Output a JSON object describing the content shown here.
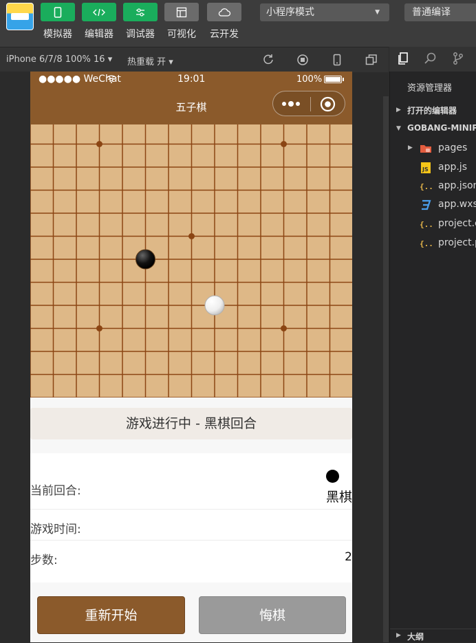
{
  "toolbar": {
    "buttons": [
      {
        "label": "模拟器",
        "icon": "phone-icon"
      },
      {
        "label": "编辑器",
        "icon": "code-icon"
      },
      {
        "label": "调试器",
        "icon": "sliders-icon"
      },
      {
        "label": "可视化",
        "icon": "layout-icon"
      },
      {
        "label": "云开发",
        "icon": "cloud-icon"
      }
    ],
    "mode": "小程序模式",
    "compile": "普通编译"
  },
  "subbar": {
    "device": "iPhone 6/7/8 100% 16 ▾",
    "hot_reload": "热重载 开 ▾"
  },
  "explorer": {
    "title": "资源管理器",
    "open_editors": "打开的编辑器",
    "project": "GOBANG-MINIPROGRAM",
    "files": [
      {
        "name": "pages",
        "icon": "folder-icon"
      },
      {
        "name": "app.js",
        "icon": "js-file-icon"
      },
      {
        "name": "app.json",
        "icon": "json-file-icon"
      },
      {
        "name": "app.wxss",
        "icon": "css-file-icon"
      },
      {
        "name": "project.config.json",
        "icon": "json-file-icon"
      },
      {
        "name": "project.private.config.json",
        "icon": "json-file-icon"
      }
    ],
    "outline": "大纲"
  },
  "phone": {
    "carrier": "●●●●● WeChat",
    "time": "19:01",
    "battery": "100%",
    "title": "五子棋",
    "game_status": "游戏进行中 - 黑棋回合",
    "rows": [
      {
        "label": "当前回合:",
        "value": "黑棋"
      },
      {
        "label": "游戏时间:",
        "value": ""
      },
      {
        "label": "步数:",
        "value": "2"
      }
    ],
    "restart": "重新开始",
    "undo": "悔棋"
  },
  "board": {
    "grid_lines": 14,
    "stones": [
      {
        "color": "black",
        "col": 5,
        "row": 6
      },
      {
        "color": "white",
        "col": 8,
        "row": 8
      }
    ],
    "star_points": [
      [
        3,
        1
      ],
      [
        11,
        1
      ],
      [
        7,
        5
      ],
      [
        3,
        9
      ],
      [
        11,
        9
      ]
    ],
    "colors": {
      "board": "#deb887",
      "line": "#8b4513",
      "accent": "#8b5a2b"
    }
  }
}
